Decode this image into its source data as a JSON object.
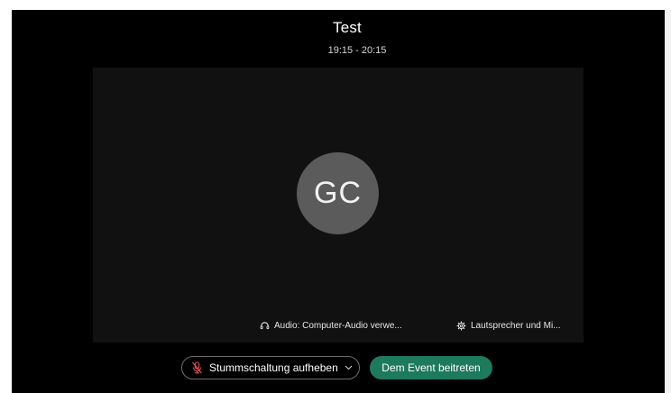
{
  "meeting": {
    "title": "Test",
    "time": "19:15 - 20:15"
  },
  "preview": {
    "avatar_initials": "GC",
    "audio_option": "Audio: Computer-Audio verwe...",
    "speaker_option": "Lautsprecher und Mi..."
  },
  "controls": {
    "unmute_label": "Stummschaltung aufheben",
    "join_label": "Dem Event beitreten"
  },
  "colors": {
    "background": "#000000",
    "preview_bg": "#111111",
    "avatar_bg": "#5b5b5b",
    "join_button": "#1e7a5c",
    "muted_mic_icon": "#e8535a"
  },
  "icons": {
    "audio": "headset-icon",
    "speaker": "gear-icon",
    "mute": "mic-off-icon",
    "dropdown": "chevron-down-icon"
  }
}
